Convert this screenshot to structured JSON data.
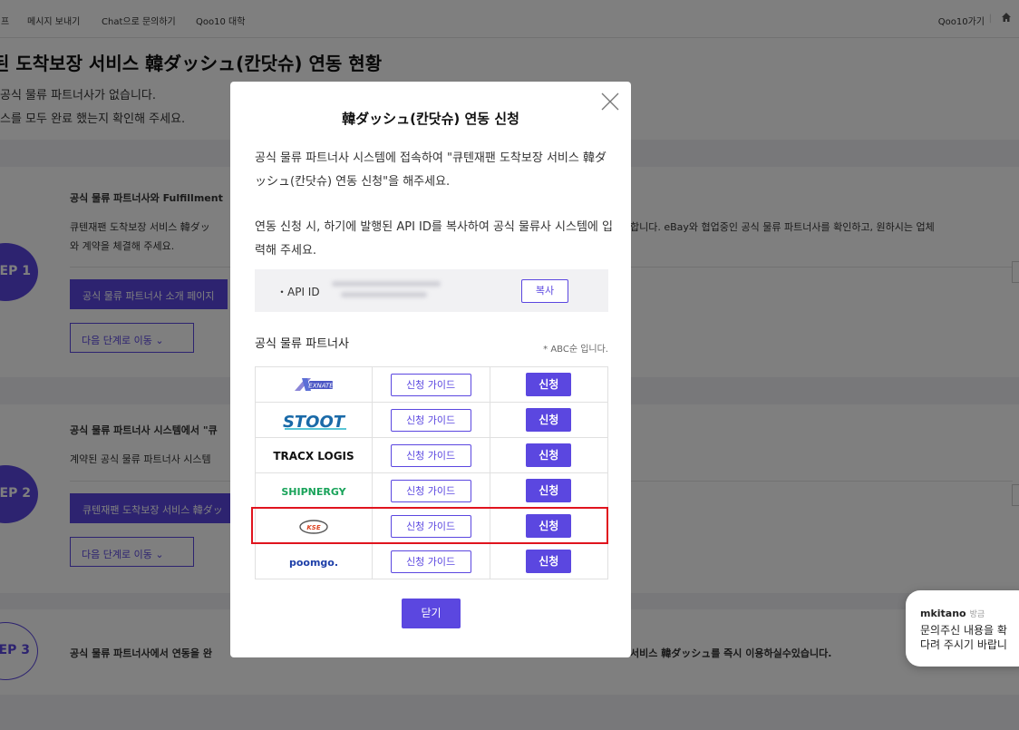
{
  "topnav": {
    "left_items": [
      "프",
      "메시지 보내기",
      "Chat으로 문의하기",
      "Qoo10 대학"
    ],
    "right_link": "Qoo10가기",
    "home_icon": "home-icon"
  },
  "page": {
    "title": "된 도착보장 서비스 韓ダッシュ(칸닷슈) 연동 현황",
    "notice_1": "공식 물류 파트너사가 없습니다.",
    "notice_2": "스를 모두 완료 했는지 확인해 주세요."
  },
  "steps": [
    {
      "label": "EP 1",
      "heading": "공식 물류 파트너사와 Fulfillment",
      "desc_left": "큐텐재팬 도착보장 서비스 韓ダッ",
      "desc_right": "합니다. eBay와 협업중인 공식 물류 파트너사를 확인하고, 원하시는 업체",
      "desc_2": "와 계약을 체결해 주세요.",
      "primary_btn": "공식 물류 파트너사 소개 페이지",
      "next_btn": "다음 단계로 이동 ⌄"
    },
    {
      "label": "EP 2",
      "heading": "공식 물류 파트너사 시스템에서 \"큐",
      "desc": "계약된 공식 물류 파트너사 시스템",
      "primary_btn": "큐텐재팬 도착보장 서비스 韓ダッ",
      "next_btn": "다음 단계로 이동 ⌄"
    },
    {
      "label": "EP 3",
      "desc_left": "공식 물류 파트너사에서 연동을 완",
      "desc_right": "서비스 韓ダッシュ를 즉시 이용하실수있습니다."
    }
  ],
  "chat": {
    "user": "mkitano",
    "time": "방금",
    "line_1": "문의주신 내용을 확",
    "line_2": "다려 주시기 바랍니"
  },
  "modal": {
    "title": "韓ダッシュ(칸닷슈) 연동 신청",
    "para_1": "공식 물류 파트너사 시스템에 접속하여 \"큐텐재팬 도착보장 서비스 韓ダッシュ(칸닷슈) 연동 신청\"을 해주세요.",
    "para_2": "연동 신청 시, 하기에 발행된 API ID를 복사하여 공식 물류사 시스템에 입력해 주세요.",
    "api_label": "・API ID",
    "copy_btn": "복사",
    "partners_heading": "공식 물류 파트너사",
    "partners_note": "* ABC순 입니다.",
    "guide_btn": "신청 가이드",
    "apply_btn": "신청",
    "close_btn": "닫기",
    "partners": [
      {
        "name": "EXNATE",
        "logo": "exnate-logo"
      },
      {
        "name": "STOOT",
        "logo": "stoot-logo"
      },
      {
        "name": "TRACX LOGIS",
        "logo": "tracx-logis-logo"
      },
      {
        "name": "SHIPNERGY",
        "logo": "shipnergy-logo"
      },
      {
        "name": "KSE",
        "logo": "kse-logo"
      },
      {
        "name": "poomgo.",
        "logo": "poomgo-logo"
      }
    ],
    "highlighted_partner": "KSE"
  },
  "colors": {
    "accent": "#5b47e0",
    "highlight": "#e0141e",
    "overlay": "rgba(0,0,0,0.5)"
  }
}
